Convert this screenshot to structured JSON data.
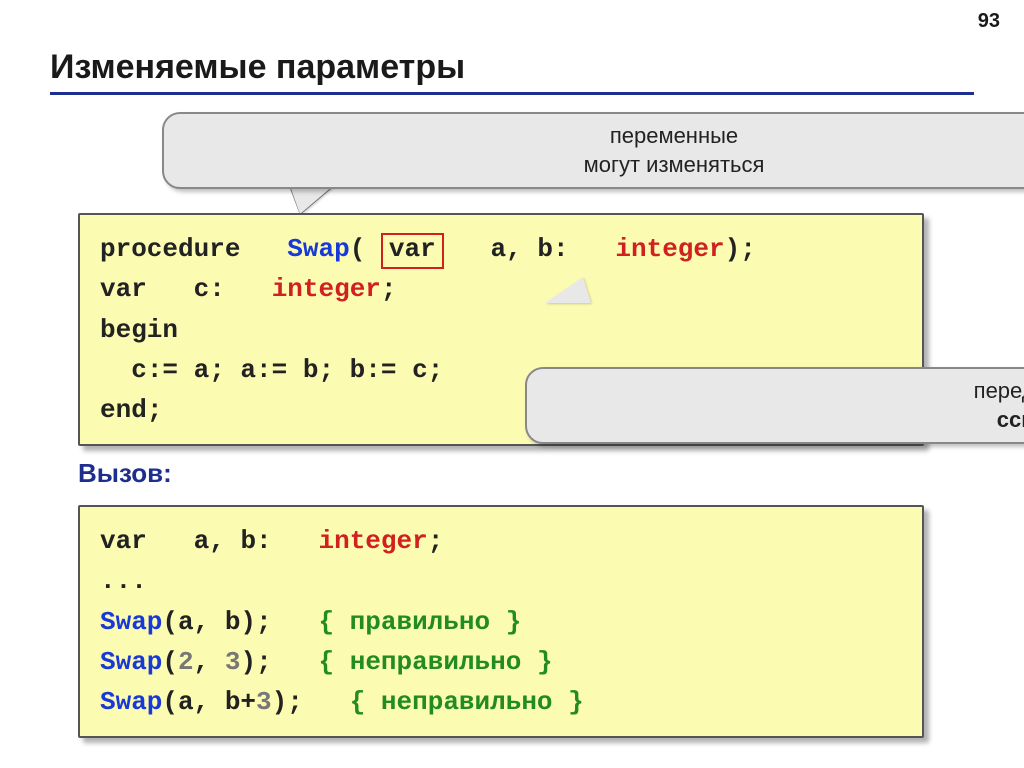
{
  "page_number": "93",
  "title": "Изменяемые параметры",
  "callout1_line1": "переменные",
  "callout1_line2": "могут изменяться",
  "callout2_line1": "передача по",
  "callout2_line2": "ссылке",
  "code1": {
    "l1": {
      "procedure": "procedure",
      "name": "Swap",
      "open": "(",
      "var": "var",
      "params": "a, b:",
      "type": "integer",
      "close": ");"
    },
    "l2": {
      "var": "var",
      "decl": "c:",
      "type": "integer",
      "semi": ";"
    },
    "l3": {
      "begin": "begin"
    },
    "l4": {
      "body": "c:= a; a:= b; b:= c;"
    },
    "l5": {
      "end": "end",
      "semi": ";"
    }
  },
  "section_label": "Вызов:",
  "code2": {
    "l1": {
      "var": "var",
      "decl": "a, b:",
      "type": "integer",
      "semi": ";"
    },
    "l2": {
      "dots": "..."
    },
    "l3": {
      "call": "Swap",
      "args": "(a, b);",
      "comment": "{ правильно }"
    },
    "l4": {
      "call": "Swap",
      "open": "(",
      "n1": "2",
      "comma": ", ",
      "n2": "3",
      "close": ");",
      "comment": "{ неправильно }"
    },
    "l5": {
      "call": "Swap",
      "open": "(a, b+",
      "n": "3",
      "close": ");",
      "comment": "{ неправильно }"
    }
  }
}
